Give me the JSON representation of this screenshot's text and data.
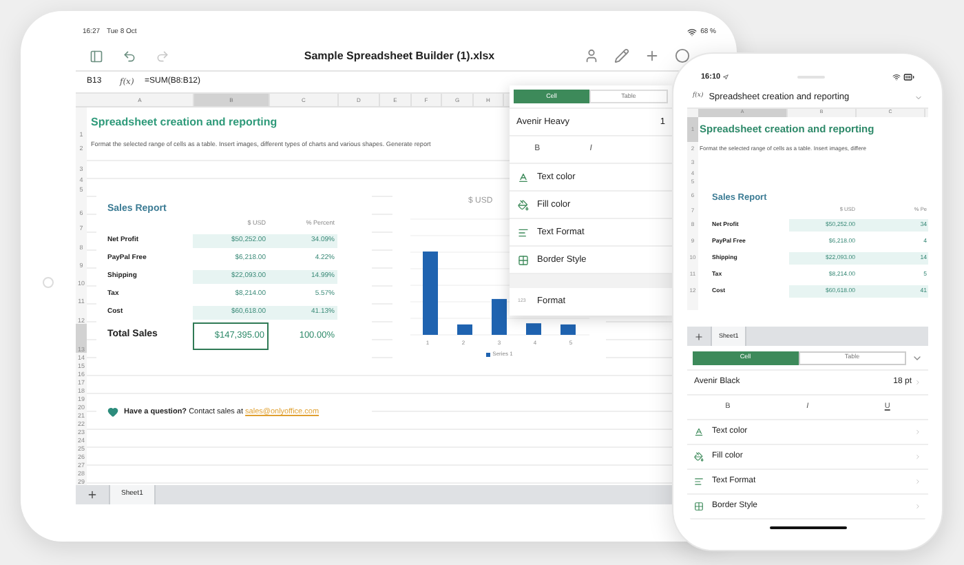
{
  "tablet": {
    "status_bar": {
      "time": "16:27",
      "date": "Tue 8 Oct",
      "battery": "68 %"
    },
    "title": "Sample Spreadsheet Builder (1).xlsx",
    "formula_bar": {
      "cell": "B13",
      "fx": "f(x)",
      "formula": "=SUM(B8:B12)"
    },
    "columns": [
      {
        "label": "A",
        "selected": false
      },
      {
        "label": "B",
        "selected": true
      },
      {
        "label": "C",
        "selected": false
      },
      {
        "label": "D",
        "selected": false
      },
      {
        "label": "E",
        "selected": false
      },
      {
        "label": "F",
        "selected": false
      },
      {
        "label": "G",
        "selected": false
      },
      {
        "label": "H",
        "selected": false
      }
    ],
    "row_numbers": [
      {
        "label": "1",
        "selected": false
      },
      {
        "label": "2",
        "selected": false
      },
      {
        "label": "3",
        "selected": false
      },
      {
        "label": "4",
        "selected": false
      },
      {
        "label": "5",
        "selected": false
      },
      {
        "label": "6",
        "selected": false
      },
      {
        "label": "7",
        "selected": false
      },
      {
        "label": "8",
        "selected": false
      },
      {
        "label": "9",
        "selected": false
      },
      {
        "label": "10",
        "selected": false
      },
      {
        "label": "11",
        "selected": false
      },
      {
        "label": "12",
        "selected": false
      },
      {
        "label": "13",
        "selected": true
      },
      {
        "label": "14",
        "selected": false
      },
      {
        "label": "15",
        "selected": false
      },
      {
        "label": "16",
        "selected": false
      },
      {
        "label": "17",
        "selected": false
      },
      {
        "label": "18",
        "selected": false
      },
      {
        "label": "19",
        "selected": false
      },
      {
        "label": "20",
        "selected": false
      },
      {
        "label": "21",
        "selected": false
      },
      {
        "label": "22",
        "selected": false
      },
      {
        "label": "23",
        "selected": false
      },
      {
        "label": "24",
        "selected": false
      },
      {
        "label": "25",
        "selected": false
      },
      {
        "label": "26",
        "selected": false
      },
      {
        "label": "27",
        "selected": false
      },
      {
        "label": "28",
        "selected": false
      },
      {
        "label": "29",
        "selected": false
      }
    ],
    "sheet_title": "Spreadsheet creation and reporting",
    "description": "Format the selected range of cells as a table. Insert images, different types of charts and various shapes. Generate report",
    "sales_report": {
      "title": "Sales Report",
      "headers": [
        "$ USD",
        "% Percent"
      ],
      "rows": [
        {
          "label": "Net Profit",
          "usd": "$50,252.00",
          "percent": "34.09%",
          "shaded": true
        },
        {
          "label": "PayPal Free",
          "usd": "$6,218.00",
          "percent": "4.22%",
          "shaded": false
        },
        {
          "label": "Shipping",
          "usd": "$22,093.00",
          "percent": "14.99%",
          "shaded": true
        },
        {
          "label": "Tax",
          "usd": "$8,214.00",
          "percent": "5.57%",
          "shaded": false
        },
        {
          "label": "Cost",
          "usd": "$60,618.00",
          "percent": "41.13%",
          "shaded": true
        }
      ],
      "total": {
        "label": "Total Sales",
        "usd": "$147,395.00",
        "percent": "100.00%",
        "selected": true
      }
    },
    "chart": {
      "title": "$ USD",
      "categories": [
        "1",
        "2",
        "3",
        "4",
        "5"
      ],
      "legend": "Series 1"
    },
    "contact": {
      "text": "**Have a question?** Contact sales at",
      "link": "sales@onlyoffice.com"
    },
    "sheet_tabs": [
      {
        "label": "Sheet1",
        "selected": true
      }
    ],
    "format_panel": {
      "tabs": [
        {
          "label": "Cell",
          "selected": true
        },
        {
          "label": "Table",
          "selected": false
        }
      ],
      "font": "Avenir Heavy",
      "font_size": "1",
      "styles": [
        "B",
        "I"
      ],
      "items": [
        {
          "label": "Text color",
          "kind": "text-color"
        },
        {
          "label": "Fill color",
          "kind": "fill-color"
        },
        {
          "label": "Text Format",
          "kind": "text-format"
        },
        {
          "label": "Border Style",
          "kind": "border-style"
        }
      ],
      "format": {
        "icon_text": "123",
        "label": "Format"
      }
    }
  },
  "phone": {
    "status_bar": {
      "time": "16:10"
    },
    "formula_bar": {
      "fx": "f(x)",
      "formula": "Spreadsheet creation and reporting"
    },
    "columns": [
      {
        "label": "A",
        "selected": true
      },
      {
        "label": "B",
        "selected": false
      },
      {
        "label": "C",
        "selected": false
      }
    ],
    "row_numbers": [
      {
        "label": "1",
        "selected": true
      },
      {
        "label": "2",
        "selected": false
      },
      {
        "label": "3",
        "selected": false
      },
      {
        "label": "4",
        "selected": false
      },
      {
        "label": "5",
        "selected": false
      },
      {
        "label": "6",
        "selected": false
      },
      {
        "label": "7",
        "selected": false
      },
      {
        "label": "8",
        "selected": false
      },
      {
        "label": "9",
        "selected": false
      },
      {
        "label": "10",
        "selected": false
      },
      {
        "label": "11",
        "selected": false
      },
      {
        "label": "12",
        "selected": false
      }
    ],
    "sheet_title": "Spreadsheet creation and reporting",
    "description": "Format the selected range of cells as a table. Insert images, differe",
    "sales_report": {
      "title": "Sales Report",
      "headers": [
        "$ USD",
        "% Pe"
      ],
      "rows": [
        {
          "label": "Net Profit",
          "usd": "$50,252.00",
          "percent": "34",
          "shaded": true
        },
        {
          "label": "PayPal Free",
          "usd": "$6,218.00",
          "percent": "4",
          "shaded": false
        },
        {
          "label": "Shipping",
          "usd": "$22,093.00",
          "percent": "14",
          "shaded": true
        },
        {
          "label": "Tax",
          "usd": "$8,214.00",
          "percent": "5",
          "shaded": false
        },
        {
          "label": "Cost",
          "usd": "$60,618.00",
          "percent": "41",
          "shaded": true
        }
      ]
    },
    "sheet_tabs": [
      {
        "label": "Sheet1",
        "selected": true
      }
    ],
    "format_panel": {
      "tabs": [
        {
          "label": "Cell",
          "selected": true
        },
        {
          "label": "Table",
          "selected": false
        }
      ],
      "font": "Avenir Black",
      "font_size": "18 pt",
      "styles": [
        "B",
        "I",
        "U"
      ],
      "items": [
        {
          "label": "Text color",
          "kind": "text-color"
        },
        {
          "label": "Fill color",
          "kind": "fill-color"
        },
        {
          "label": "Text Format",
          "kind": "text-format"
        },
        {
          "label": "Border Style",
          "kind": "border-style"
        }
      ]
    }
  }
}
